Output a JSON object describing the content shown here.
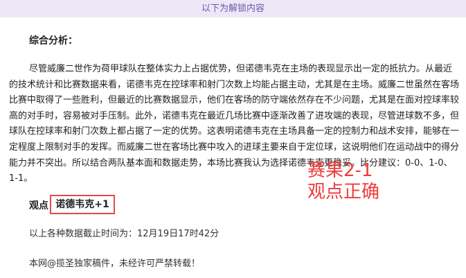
{
  "unlock_bar": {
    "text": "以下为解锁内容"
  },
  "article": {
    "section_title": "综合分析：",
    "analysis": "尽管威廉二世作为荷甲球队在整体实力上占据优势，但诺德韦克在主场的表现显示出一定的抵抗力。从最近的技术统计和比赛数据来看，诺德韦克在控球率和射门次数上均能占据主动，尤其是在主场。威廉二世虽然在客场比赛中取得了一些胜利，但最近的比赛数据显示，他们在客场的防守端依然存在不少问题，尤其是在面对控球率较高的对手时，容易被对手压制。此外，诺德韦克在最近几场比赛中逐渐改善了进攻端的表现，尽管进球数不多，但球队在控球率和射门次数上都占据了一定的优势。这表明诺德韦克在主场具备一定的控制力和战术安排，能够在一定程度上限制对手的发挥。而威廉二世在客场比赛中攻入的进球主要来自于定位球，这说明他们在运动战中的得分能力并不突出。所以结合两队基本面和数据走势，本场比赛我认为选择诺德韦克更稳妥。比分建议：0-0、1-0、1-1。",
    "viewpoint_label": "观点",
    "viewpoint_value": "诺德韦克+1",
    "data_time": "以上各种数据截止时间为：12月19日17时42分",
    "copyright": "本网@揽圣独家稿件，未经许可严禁转载！"
  },
  "annotation": {
    "line1": "赛果2-1",
    "line2": "观点正确",
    "color": "#ef3b3b"
  },
  "colors": {
    "unlock_bar_bg": "#ece8f7",
    "unlock_bar_text": "#6a5aa8",
    "highlight_border": "#e34a4a"
  }
}
